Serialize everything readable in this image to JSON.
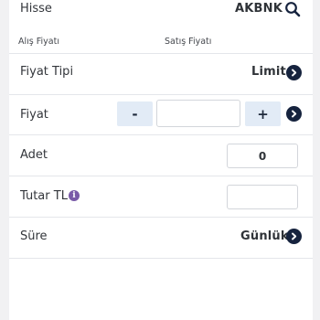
{
  "header": {
    "label": "Hisse",
    "symbol": "AKBNK"
  },
  "price_labels": {
    "buy": "Alış Fiyatı",
    "sell": "Satış Fiyatı"
  },
  "order_type": {
    "label": "Fiyat Tipi",
    "value": "Limit"
  },
  "price": {
    "label": "Fiyat",
    "decrement": "-",
    "increment": "+",
    "value": ""
  },
  "quantity": {
    "label": "Adet",
    "value": "0"
  },
  "amount": {
    "label": "Tutar TL",
    "info": "i",
    "value": ""
  },
  "duration": {
    "label": "Süre",
    "value": "Günlük"
  },
  "icons": {
    "search": "search-icon",
    "next": "chevron-right-circle-icon",
    "info": "info-icon"
  },
  "colors": {
    "dark_button": "#16233e",
    "stepper_bg": "#e2ebf6",
    "info": "#7a5aa8",
    "background": "#f1f1f3"
  }
}
